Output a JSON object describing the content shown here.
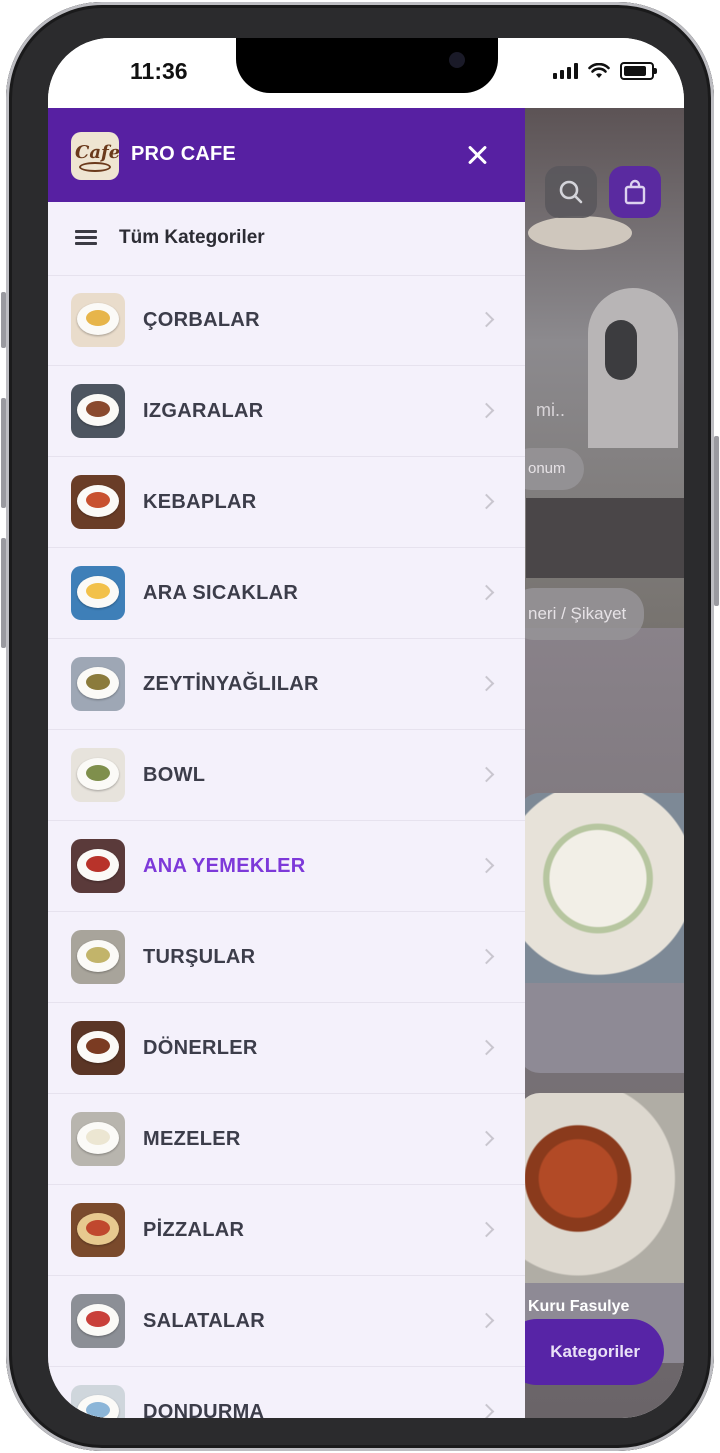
{
  "status_bar": {
    "time": "11:36"
  },
  "drawer": {
    "brand": "PRO CAFE",
    "logo_text": "Cafe",
    "all_categories_label": "Tüm Kategoriler",
    "categories": [
      {
        "label": "ÇORBALAR",
        "active": false
      },
      {
        "label": "IZGARALAR",
        "active": false
      },
      {
        "label": "KEBAPLAR",
        "active": false
      },
      {
        "label": "ARA SICAKLAR",
        "active": false
      },
      {
        "label": "ZEYTİNYAĞLILAR",
        "active": false
      },
      {
        "label": "BOWL",
        "active": false
      },
      {
        "label": "ANA YEMEKLER",
        "active": true
      },
      {
        "label": "TURŞULAR",
        "active": false
      },
      {
        "label": "DÖNERLER",
        "active": false
      },
      {
        "label": "MEZELER",
        "active": false
      },
      {
        "label": "PİZZALAR",
        "active": false
      },
      {
        "label": "SALATALAR",
        "active": false
      },
      {
        "label": "DONDURMA",
        "active": false
      }
    ]
  },
  "background": {
    "hero_text_fragment": "mi..",
    "location_pill": "onum",
    "feedback_pill": "neri / Şikayet",
    "product_card_2_title": "Kuru Fasulye",
    "categories_button": "Kategoriler"
  },
  "colors": {
    "header_purple": "#5720a2",
    "active_purple": "#7d39d9",
    "drawer_bg": "#f4f1fb",
    "label_gray": "#3c3d4a"
  }
}
